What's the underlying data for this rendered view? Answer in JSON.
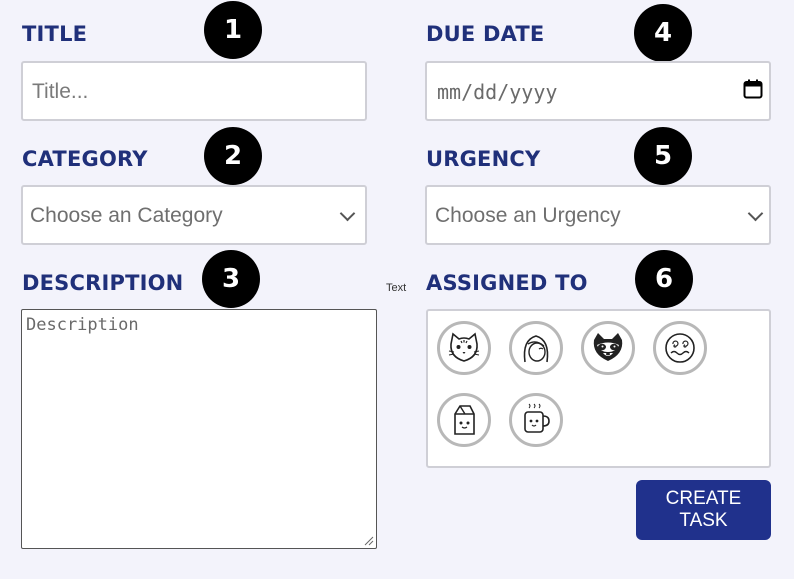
{
  "form": {
    "title": {
      "label": "TITLE",
      "badge": "1",
      "placeholder": "Title..."
    },
    "due_date": {
      "label": "DUE DATE",
      "badge": "4",
      "placeholder": "mm/dd/yyyy",
      "icon": "calendar-icon"
    },
    "category": {
      "label": "CATEGORY",
      "badge": "2",
      "selected": "Choose an Category"
    },
    "urgency": {
      "label": "URGENCY",
      "badge": "5",
      "selected": "Choose an Urgency"
    },
    "description": {
      "label": "DESCRIPTION",
      "badge": "3",
      "placeholder": "Description"
    },
    "assigned_to": {
      "label": "ASSIGNED TO",
      "badge": "6",
      "side_text": "Text",
      "avatars": [
        "cat-avatar-icon",
        "girl-avatar-icon",
        "raccoon-avatar-icon",
        "swirl-face-avatar-icon",
        "milk-carton-avatar-icon",
        "mug-avatar-icon"
      ]
    },
    "create_button": {
      "line1": "CREATE",
      "line2": "TASK"
    }
  },
  "colors": {
    "label": "#20307a",
    "button": "#20318c",
    "badge": "#000000"
  }
}
